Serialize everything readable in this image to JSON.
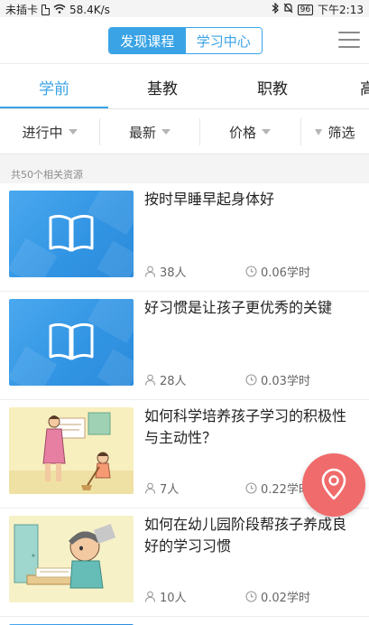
{
  "status_bar": {
    "carrier": "未插卡",
    "speed": "58.4K/s",
    "battery": "96",
    "time": "下午2:13"
  },
  "header": {
    "segments": [
      {
        "label": "发现课程",
        "active": true
      },
      {
        "label": "学习中心",
        "active": false
      }
    ],
    "menu_icon": "hamburger-menu-icon"
  },
  "tabs": [
    {
      "label": "学前",
      "active": true
    },
    {
      "label": "基教",
      "active": false
    },
    {
      "label": "职教",
      "active": false
    },
    {
      "label": "高",
      "active": false
    }
  ],
  "filters": [
    {
      "label": "进行中"
    },
    {
      "label": "最新"
    },
    {
      "label": "价格"
    },
    {
      "label": "筛选"
    }
  ],
  "result_count": "共50个相关资源",
  "courses": [
    {
      "title": "按时早睡早起身体好",
      "learners": "38人",
      "hours": "0.06学时",
      "thumbnail": "book-icon"
    },
    {
      "title": "好习惯是让孩子更优秀的关键",
      "learners": "28人",
      "hours": "0.03学时",
      "thumbnail": "book-icon"
    },
    {
      "title": "如何科学培养孩子学习的积极性与主动性？",
      "learners": "7人",
      "hours": "0.22学时",
      "thumbnail": "cartoon-sweeping"
    },
    {
      "title": "如何在幼儿园阶段帮孩子养成良好的学习习惯",
      "learners": "10人",
      "hours": "0.02学时",
      "thumbnail": "cartoon-studying"
    }
  ],
  "fab": {
    "icon": "location-pin-icon",
    "color": "#f06b6b"
  },
  "colors": {
    "accent": "#3aa3e6"
  }
}
